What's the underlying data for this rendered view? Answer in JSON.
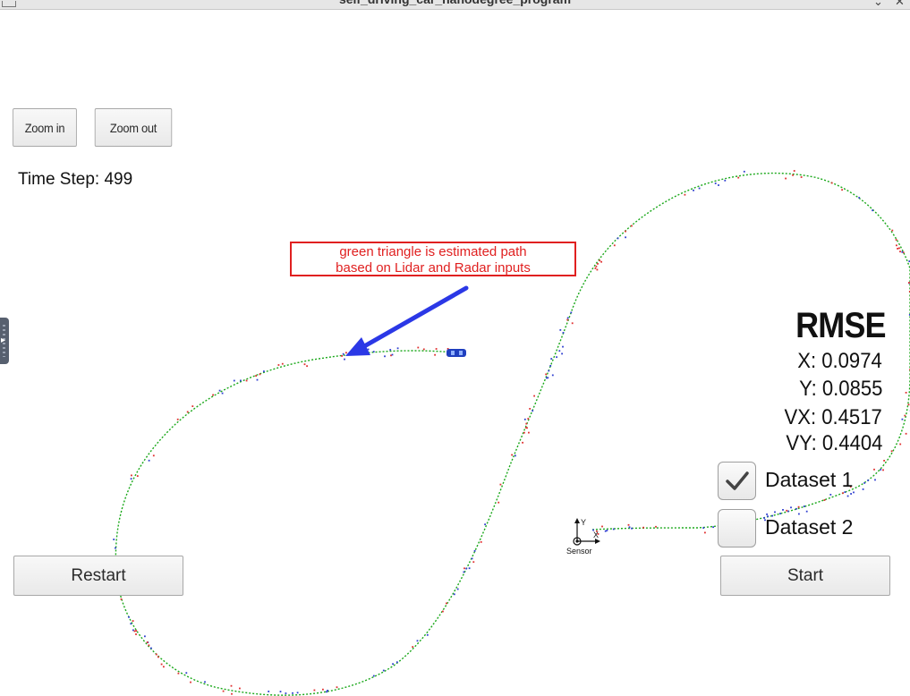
{
  "window": {
    "title": "self_driving_car_nanodegree_program"
  },
  "controls": {
    "zoom_in_label": "Zoom in",
    "zoom_out_label": "Zoom out",
    "restart_label": "Restart",
    "start_label": "Start"
  },
  "status": {
    "time_step_text": "Time Step: 499"
  },
  "annotation": {
    "line1": "green triangle is estimated path",
    "line2": "based on Lidar and Radar inputs"
  },
  "rmse": {
    "title": "RMSE",
    "x": "X: 0.0974",
    "y": "Y: 0.0855",
    "vx": "VX: 0.4517",
    "vy": "VY: 0.4404"
  },
  "datasets": [
    {
      "label": "Dataset 1",
      "checked": true
    },
    {
      "label": "Dataset 2",
      "checked": false
    }
  ],
  "sensor": {
    "label": "Sensor",
    "axis_x": "X",
    "axis_y": "Y"
  },
  "colors": {
    "estimated_path": "#1aa81a",
    "lidar_marker": "#e03030",
    "radar_marker": "#3040d0",
    "arrow": "#2b38e6",
    "annotation": "#e02020",
    "car": "#1f3fbf"
  }
}
